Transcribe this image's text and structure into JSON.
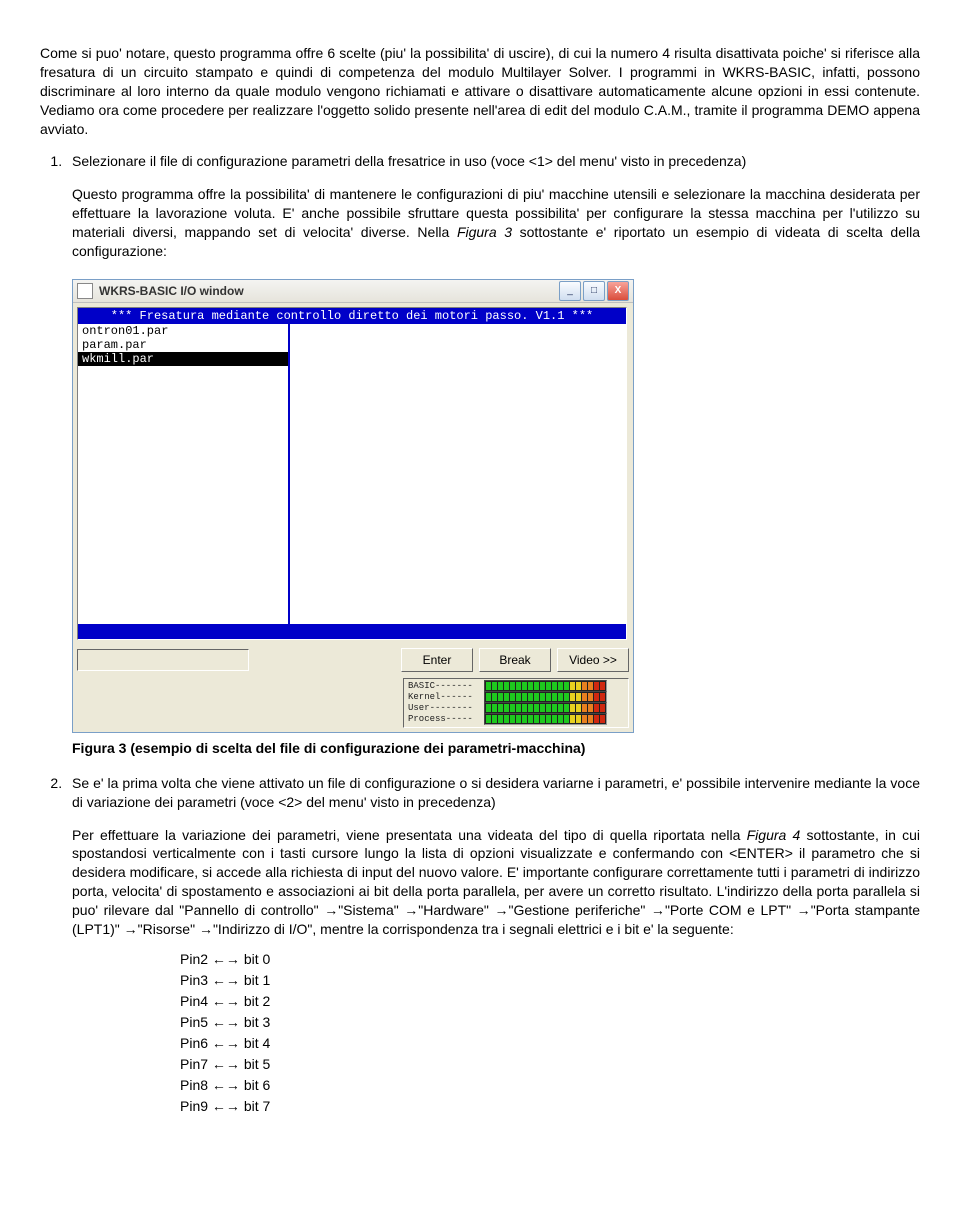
{
  "para_intro": "Come si puo' notare, questo programma offre 6 scelte (piu' la possibilita' di uscire), di cui la numero 4 risulta disattivata poiche' si riferisce alla fresatura di un circuito stampato e quindi di competenza del modulo Multilayer Solver. I programmi in WKRS-BASIC, infatti, possono discriminare al loro interno da quale modulo vengono richiamati e attivare o disattivare automaticamente alcune opzioni in essi contenute. Vediamo ora come procedere per realizzare l'oggetto solido presente nell'area di edit del modulo C.A.M., tramite il programma DEMO appena avviato.",
  "item1_lead": "Selezionare il file di configurazione parametri della fresatrice in uso (voce <1> del menu' visto in precedenza)",
  "item1_body_a": "Questo programma offre la possibilita' di mantenere le configurazioni di piu' macchine utensili e selezionare la macchina desiderata per effettuare la lavorazione voluta. E' anche possibile sfruttare questa possibilita' per configurare la stessa macchina per l'utilizzo su materiali diversi, mappando set di velocita' diverse. Nella ",
  "item1_body_fig": "Figura 3",
  "item1_body_b": " sottostante e' riportato un esempio di videata di scelta della configurazione:",
  "window_title": "WKRS-BASIC I/O window",
  "term_header": "*** Fresatura mediante controllo diretto dei motori passo. V1.1 ***",
  "files": [
    "ontron01.par",
    "param.par",
    "wkmill.par"
  ],
  "selected_file_index": 2,
  "buttons": {
    "enter": "Enter",
    "break": "Break",
    "video": "Video >>"
  },
  "meters": [
    "BASIC-------",
    "Kernel------",
    "User--------",
    "Process-----"
  ],
  "caption_fig3": "Figura 3 (esempio di scelta del file di configurazione dei parametri-macchina)",
  "item2_lead": "Se e' la prima volta che viene attivato un file di configurazione o si desidera variarne i parametri, e' possibile intervenire mediante la voce di variazione dei parametri (voce <2> del menu' visto in precedenza)",
  "item2_body_a": "Per effettuare la variazione dei parametri, viene presentata una videata del tipo di quella riportata nella ",
  "item2_body_fig": "Figura 4",
  "item2_body_b": " sottostante, in cui spostandosi verticalmente con i tasti cursore lungo la lista di opzioni visualizzate e confermando con <ENTER> il parametro che si desidera modificare, si accede alla richiesta di input del nuovo valore. E' importante configurare correttamente tutti i parametri di indirizzo porta, velocita' di spostamento e associazioni ai bit della porta parallela, per avere un corretto risultato. L'indirizzo della porta parallela si puo' rilevare dal \"Pannello di controllo\" ",
  "nav_steps": [
    "\"Sistema\"",
    "\"Hardware\"",
    "\"Gestione periferiche\"",
    "\"Porte COM e LPT\"",
    "\"Porta stampante (LPT1)\"",
    "\"Risorse\"",
    "\"Indirizzo di I/O\""
  ],
  "item2_body_c": ", mentre la corrispondenza tra i segnali elettrici e i bit e' la seguente:",
  "pins": [
    {
      "pin": "Pin2",
      "bit": "bit 0"
    },
    {
      "pin": "Pin3",
      "bit": "bit 1"
    },
    {
      "pin": "Pin4",
      "bit": "bit 2"
    },
    {
      "pin": "Pin5",
      "bit": "bit 3"
    },
    {
      "pin": "Pin6",
      "bit": "bit 4"
    },
    {
      "pin": "Pin7",
      "bit": "bit 5"
    },
    {
      "pin": "Pin8",
      "bit": "bit 6"
    },
    {
      "pin": "Pin9",
      "bit": "bit 7"
    }
  ]
}
